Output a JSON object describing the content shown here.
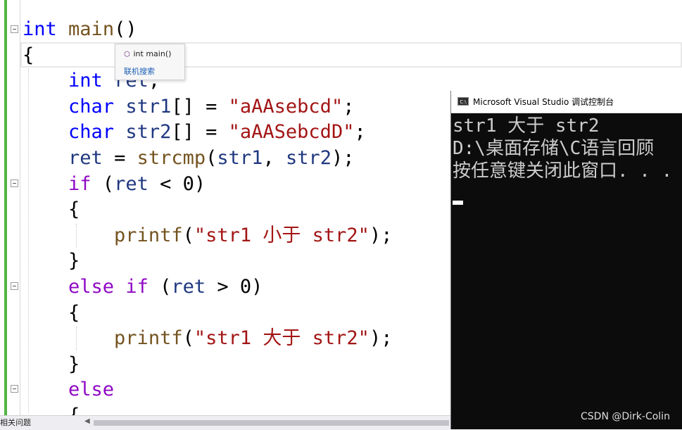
{
  "editor": {
    "lines": [
      [
        {
          "t": "int",
          "c": "kw-blue"
        },
        {
          "t": " "
        },
        {
          "t": "main",
          "c": "fn"
        },
        {
          "t": "()"
        }
      ],
      [
        {
          "t": "{"
        }
      ],
      [
        {
          "t": "    "
        },
        {
          "t": "int",
          "c": "kw-blue"
        },
        {
          "t": " "
        },
        {
          "t": "ret",
          "c": "var"
        },
        {
          "t": ";"
        }
      ],
      [
        {
          "t": "    "
        },
        {
          "t": "char",
          "c": "kw-blue"
        },
        {
          "t": " "
        },
        {
          "t": "str1",
          "c": "var"
        },
        {
          "t": "[] = "
        },
        {
          "t": "\"aAAsebcd\"",
          "c": "str"
        },
        {
          "t": ";"
        }
      ],
      [
        {
          "t": "    "
        },
        {
          "t": "char",
          "c": "kw-blue"
        },
        {
          "t": " "
        },
        {
          "t": "str2",
          "c": "var"
        },
        {
          "t": "[] = "
        },
        {
          "t": "\"aAASebcdD\"",
          "c": "str"
        },
        {
          "t": ";"
        }
      ],
      [
        {
          "t": "    "
        },
        {
          "t": "ret",
          "c": "var"
        },
        {
          "t": " = "
        },
        {
          "t": "strcmp",
          "c": "fn"
        },
        {
          "t": "("
        },
        {
          "t": "str1",
          "c": "var"
        },
        {
          "t": ", "
        },
        {
          "t": "str2",
          "c": "var"
        },
        {
          "t": ");"
        }
      ],
      [
        {
          "t": "    "
        },
        {
          "t": "if",
          "c": "kw-purple"
        },
        {
          "t": " ("
        },
        {
          "t": "ret",
          "c": "var"
        },
        {
          "t": " < 0)"
        }
      ],
      [
        {
          "t": "    {"
        }
      ],
      [
        {
          "t": "        "
        },
        {
          "t": "printf",
          "c": "fn"
        },
        {
          "t": "("
        },
        {
          "t": "\"str1 小于 str2\"",
          "c": "str"
        },
        {
          "t": ");"
        }
      ],
      [
        {
          "t": "    }"
        }
      ],
      [
        {
          "t": "    "
        },
        {
          "t": "else",
          "c": "kw-purple"
        },
        {
          "t": " "
        },
        {
          "t": "if",
          "c": "kw-purple"
        },
        {
          "t": " ("
        },
        {
          "t": "ret",
          "c": "var"
        },
        {
          "t": " > 0)"
        }
      ],
      [
        {
          "t": "    {"
        }
      ],
      [
        {
          "t": "        "
        },
        {
          "t": "printf",
          "c": "fn"
        },
        {
          "t": "("
        },
        {
          "t": "\"str1 大于 str2\"",
          "c": "str"
        },
        {
          "t": ");"
        }
      ],
      [
        {
          "t": "    }"
        }
      ],
      [
        {
          "t": "    "
        },
        {
          "t": "else",
          "c": "kw-purple"
        }
      ],
      [
        {
          "t": "    {"
        }
      ]
    ]
  },
  "tooltip": {
    "icon": "cube-icon",
    "signature": "int main()",
    "link": "联机搜索"
  },
  "console": {
    "title": "Microsoft Visual Studio 调试控制台",
    "icon_label": "C:\\",
    "lines": [
      "str1 大于 str2",
      "D:\\桌面存储\\C语言回顾",
      "按任意键关闭此窗口. . ."
    ]
  },
  "statusbar": {
    "label": "相关问题",
    "scroll_left": "◀"
  },
  "watermark": "CSDN @Dirk-Colin",
  "colors": {
    "keyword": "#0000ff",
    "control": "#8f08c4",
    "function": "#74531f",
    "variable": "#1f377f",
    "string": "#a31515",
    "change_bar": "#52b541"
  }
}
